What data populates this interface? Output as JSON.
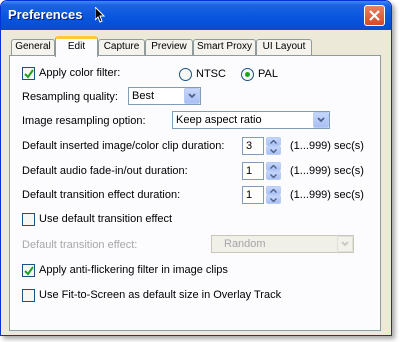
{
  "window": {
    "title": "Preferences"
  },
  "tabs": [
    {
      "label": "General"
    },
    {
      "label": "Edit"
    },
    {
      "label": "Capture"
    },
    {
      "label": "Preview"
    },
    {
      "label": "Smart Proxy"
    },
    {
      "label": "UI Layout"
    }
  ],
  "active_tab": "Edit",
  "edit": {
    "color_filter": {
      "label": "Apply color filter:",
      "checked": true
    },
    "ntsc": {
      "label": "NTSC",
      "selected": false
    },
    "pal": {
      "label": "PAL",
      "selected": true
    },
    "resampling_quality": {
      "label": "Resampling quality:",
      "value": "Best"
    },
    "image_resampling": {
      "label": "Image resampling option:",
      "value": "Keep aspect ratio"
    },
    "clip_duration": {
      "label": "Default inserted image/color clip duration:",
      "value": "3",
      "range": "(1...999) sec(s)"
    },
    "audio_fade": {
      "label": "Default audio fade-in/out duration:",
      "value": "1",
      "range": "(1...999) sec(s)"
    },
    "transition_duration": {
      "label": "Default transition effect duration:",
      "value": "1",
      "range": "(1...999) sec(s)"
    },
    "use_default_transition": {
      "label": "Use default transition effect",
      "checked": false
    },
    "default_transition": {
      "label": "Default transition effect:",
      "value": "Random"
    },
    "anti_flicker": {
      "label": "Apply anti-flickering filter in image clips",
      "checked": true
    },
    "fit_to_screen": {
      "label": "Use Fit-to-Screen as default size in Overlay Track",
      "checked": false
    }
  }
}
